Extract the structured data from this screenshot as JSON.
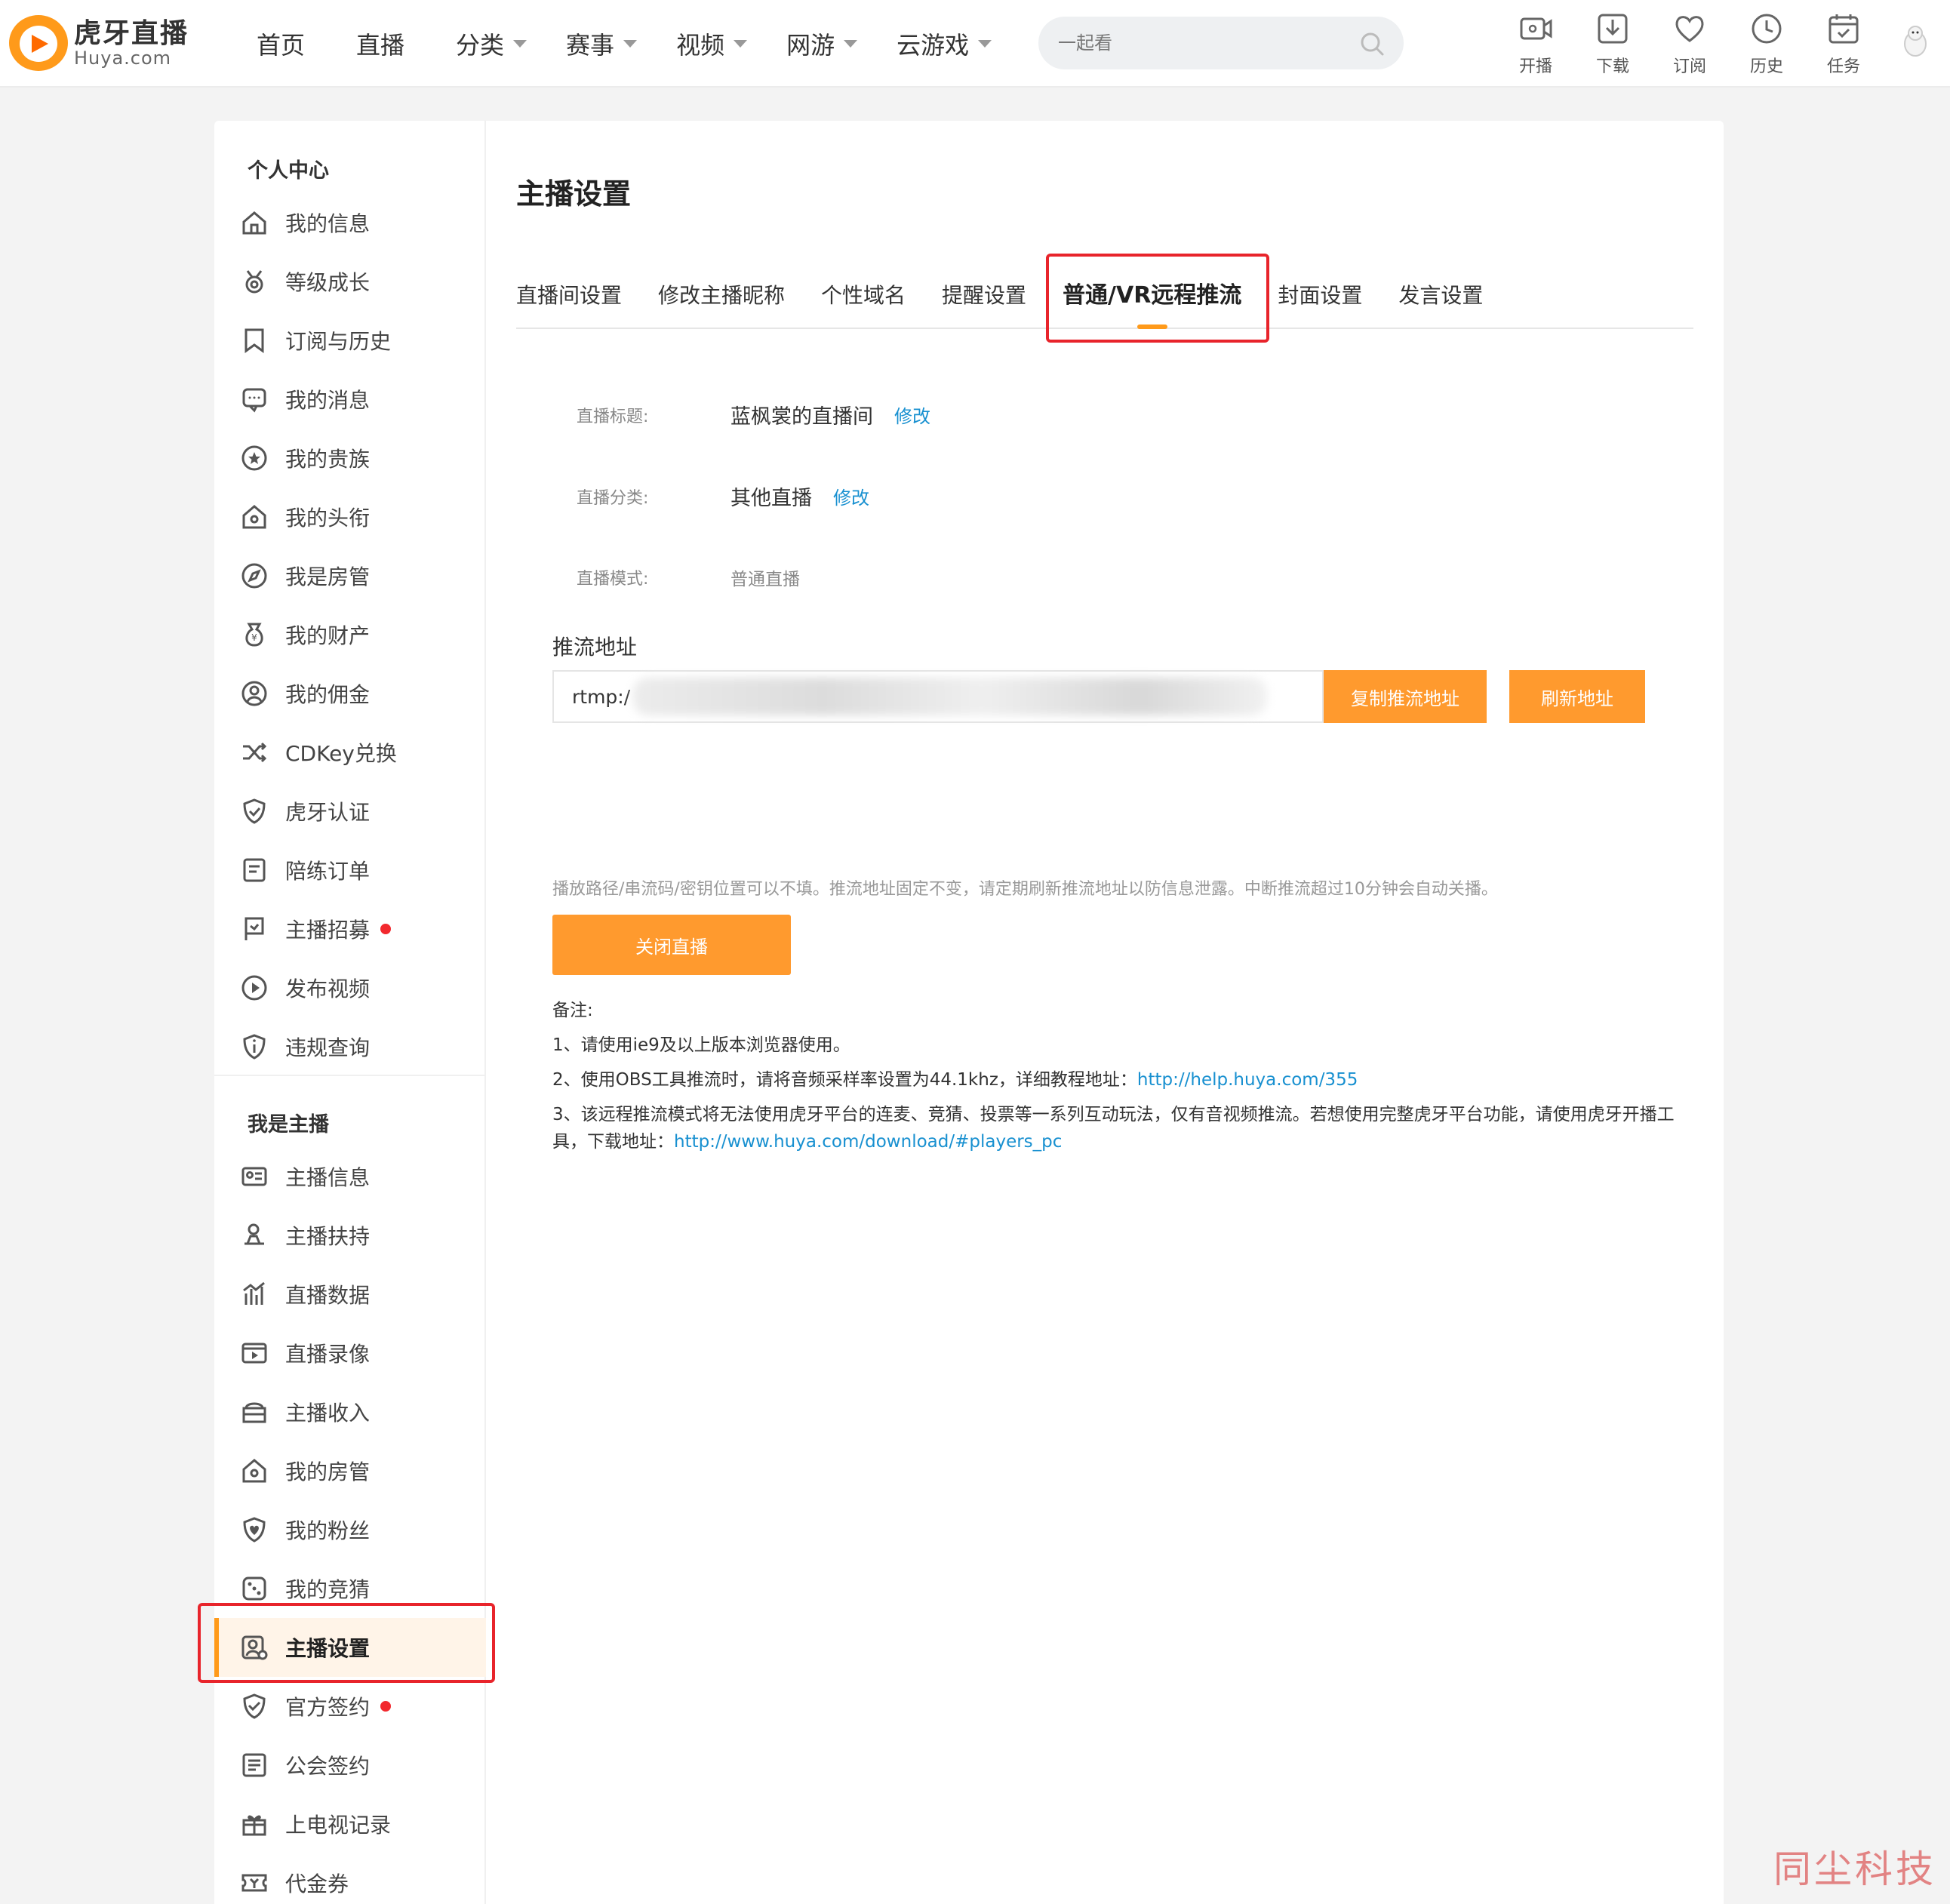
{
  "logo": {
    "cn": "虎牙直播",
    "en": "Huya.com"
  },
  "nav": [
    {
      "label": "首页",
      "dropdown": false
    },
    {
      "label": "直播",
      "dropdown": false
    },
    {
      "label": "分类",
      "dropdown": true
    },
    {
      "label": "赛事",
      "dropdown": true
    },
    {
      "label": "视频",
      "dropdown": true
    },
    {
      "label": "网游",
      "dropdown": true
    },
    {
      "label": "云游戏",
      "dropdown": true
    }
  ],
  "search": {
    "placeholder": "一起看"
  },
  "tools": [
    {
      "label": "开播",
      "icon": "camera-icon"
    },
    {
      "label": "下载",
      "icon": "download-icon"
    },
    {
      "label": "订阅",
      "icon": "heart-icon"
    },
    {
      "label": "历史",
      "icon": "clock-icon"
    },
    {
      "label": "任务",
      "icon": "calendar-icon"
    }
  ],
  "sidebar": {
    "section1_title": "个人中心",
    "section1_items": [
      {
        "label": "我的信息",
        "icon": "home-icon"
      },
      {
        "label": "等级成长",
        "icon": "medal-icon"
      },
      {
        "label": "订阅与历史",
        "icon": "bookmark-icon"
      },
      {
        "label": "我的消息",
        "icon": "message-icon"
      },
      {
        "label": "我的贵族",
        "icon": "star-circle-icon"
      },
      {
        "label": "我的头衔",
        "icon": "house-badge-icon"
      },
      {
        "label": "我是房管",
        "icon": "compass-icon"
      },
      {
        "label": "我的财产",
        "icon": "money-bag-icon"
      },
      {
        "label": "我的佣金",
        "icon": "coin-icon"
      },
      {
        "label": "CDKey兑换",
        "icon": "shuffle-icon"
      },
      {
        "label": "虎牙认证",
        "icon": "shield-check-icon"
      },
      {
        "label": "陪练订单",
        "icon": "order-icon"
      },
      {
        "label": "主播招募",
        "icon": "flag-icon",
        "dot": true
      },
      {
        "label": "发布视频",
        "icon": "play-circle-icon"
      },
      {
        "label": "违规查询",
        "icon": "info-icon"
      }
    ],
    "section2_title": "我是主播",
    "section2_items": [
      {
        "label": "主播信息",
        "icon": "id-card-icon"
      },
      {
        "label": "主播扶持",
        "icon": "support-icon"
      },
      {
        "label": "直播数据",
        "icon": "chart-icon"
      },
      {
        "label": "直播录像",
        "icon": "video-icon"
      },
      {
        "label": "主播收入",
        "icon": "wallet-icon"
      },
      {
        "label": "我的房管",
        "icon": "house-badge-icon"
      },
      {
        "label": "我的粉丝",
        "icon": "heart-shield-icon"
      },
      {
        "label": "我的竞猜",
        "icon": "dice-icon"
      },
      {
        "label": "主播设置",
        "icon": "user-settings-icon",
        "active": true
      },
      {
        "label": "官方签约",
        "icon": "contract-icon",
        "dot": true
      },
      {
        "label": "公会签约",
        "icon": "document-icon"
      },
      {
        "label": "上电视记录",
        "icon": "gift-icon"
      },
      {
        "label": "代金券",
        "icon": "ticket-icon"
      }
    ]
  },
  "main": {
    "title": "主播设置",
    "tabs": [
      {
        "label": "直播间设置"
      },
      {
        "label": "修改主播昵称"
      },
      {
        "label": "个性域名"
      },
      {
        "label": "提醒设置"
      },
      {
        "label": "普通/VR远程推流",
        "active": true
      },
      {
        "label": "封面设置"
      },
      {
        "label": "发言设置"
      }
    ],
    "fields": {
      "title_label": "直播标题:",
      "title_value": "蓝枫裳的直播间",
      "title_edit": "修改",
      "category_label": "直播分类:",
      "category_value": "其他直播",
      "category_edit": "修改",
      "mode_label": "直播模式:",
      "mode_value": "普通直播"
    },
    "stream": {
      "label": "推流地址",
      "prefix": "rtmp:/",
      "copy_button": "复制推流地址",
      "refresh_button": "刷新地址",
      "hint": "播放路径/串流码/密钥位置可以不填。推流地址固定不变，请定期刷新推流地址以防信息泄露。中断推流超过10分钟会自动关播。",
      "close_button": "关闭直播"
    },
    "notes": {
      "title": "备注:",
      "line1": "1、请使用ie9及以上版本浏览器使用。",
      "line2": "2、使用OBS工具推流时，请将音频采样率设置为44.1khz，详细教程地址：",
      "line2_link": "http://help.huya.com/355",
      "line3": "3、该远程推流模式将无法使用虎牙平台的连麦、竞猜、投票等一系列互动玩法，仅有音视频推流。若想使用完整虎牙平台功能，请使用虎牙开播工具，下载地址：",
      "line3_link": "http://www.huya.com/download/#players_pc"
    }
  },
  "watermark": "同尘科技",
  "colors": {
    "accent": "#ff9a2e",
    "link": "#1890d0",
    "highlight": "#e8242b",
    "dot": "#f2292e"
  }
}
